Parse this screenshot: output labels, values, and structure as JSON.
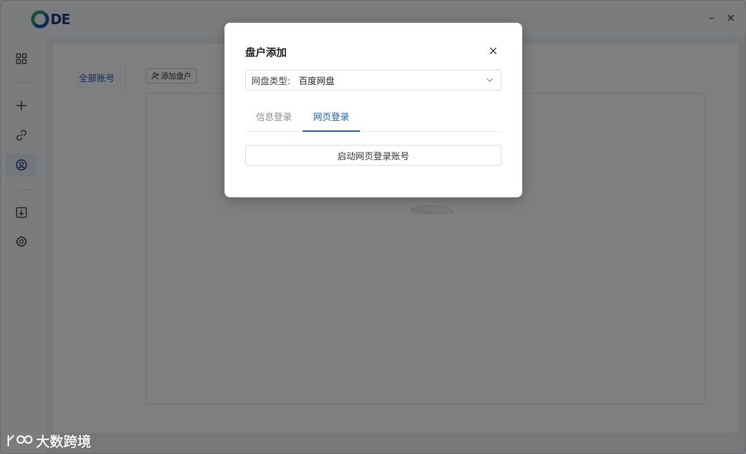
{
  "app": {
    "logo_text": "DE"
  },
  "window": {
    "minimize": "–",
    "close": "×"
  },
  "sidebar": {
    "items": [
      {
        "icon": "dashboard-icon",
        "active": false
      },
      {
        "icon": "plus-icon",
        "active": false
      },
      {
        "icon": "link-icon",
        "active": false
      },
      {
        "icon": "account-icon",
        "active": true
      },
      {
        "icon": "download-icon",
        "active": false
      },
      {
        "icon": "settings-icon",
        "active": false
      }
    ]
  },
  "main": {
    "account_tab": "全部账号",
    "add_button": "添加盘户"
  },
  "modal": {
    "title": "盘户添加",
    "close": "×",
    "select_label": "网盘类型:",
    "select_value": "百度网盘",
    "tabs": [
      {
        "label": "信息登录",
        "active": false
      },
      {
        "label": "网页登录",
        "active": true
      }
    ],
    "launch_button": "启动网页登录账号"
  },
  "watermark": {
    "text": "大数跨境"
  },
  "colors": {
    "accent": "#1e5ab4",
    "logo_green": "#1aa37a",
    "logo_blue": "#1e5aa8"
  }
}
